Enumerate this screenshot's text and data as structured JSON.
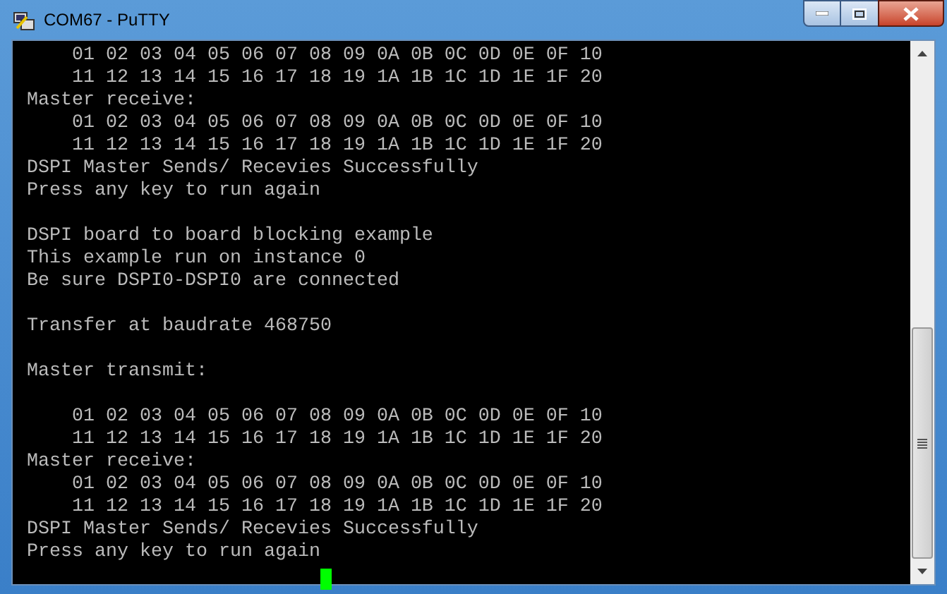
{
  "window": {
    "title": "COM67 - PuTTY"
  },
  "terminal": {
    "lines": [
      {
        "kind": "text",
        "text": "    01 02 03 04 05 06 07 08 09 0A 0B 0C 0D 0E 0F 10"
      },
      {
        "kind": "text",
        "text": "    11 12 13 14 15 16 17 18 19 1A 1B 1C 1D 1E 1F 20"
      },
      {
        "kind": "text",
        "text": "Master receive:"
      },
      {
        "kind": "text",
        "text": "    01 02 03 04 05 06 07 08 09 0A 0B 0C 0D 0E 0F 10"
      },
      {
        "kind": "text",
        "text": "    11 12 13 14 15 16 17 18 19 1A 1B 1C 1D 1E 1F 20"
      },
      {
        "kind": "text",
        "text": "DSPI Master Sends/ Recevies Successfully"
      },
      {
        "kind": "text",
        "text": "Press any key to run again"
      },
      {
        "kind": "blank"
      },
      {
        "kind": "text",
        "text": "DSPI board to board blocking example"
      },
      {
        "kind": "text",
        "text": "This example run on instance 0"
      },
      {
        "kind": "text",
        "text": "Be sure DSPI0-DSPI0 are connected"
      },
      {
        "kind": "blank"
      },
      {
        "kind": "text",
        "text": "Transfer at baudrate 468750"
      },
      {
        "kind": "blank"
      },
      {
        "kind": "text",
        "text": "Master transmit:"
      },
      {
        "kind": "blank"
      },
      {
        "kind": "text",
        "text": "    01 02 03 04 05 06 07 08 09 0A 0B 0C 0D 0E 0F 10"
      },
      {
        "kind": "text",
        "text": "    11 12 13 14 15 16 17 18 19 1A 1B 1C 1D 1E 1F 20"
      },
      {
        "kind": "text",
        "text": "Master receive:"
      },
      {
        "kind": "text",
        "text": "    01 02 03 04 05 06 07 08 09 0A 0B 0C 0D 0E 0F 10"
      },
      {
        "kind": "text",
        "text": "    11 12 13 14 15 16 17 18 19 1A 1B 1C 1D 1E 1F 20"
      },
      {
        "kind": "text",
        "text": "DSPI Master Sends/ Recevies Successfully"
      },
      {
        "kind": "text",
        "text": "Press any key to run again"
      },
      {
        "kind": "cursor"
      }
    ]
  }
}
